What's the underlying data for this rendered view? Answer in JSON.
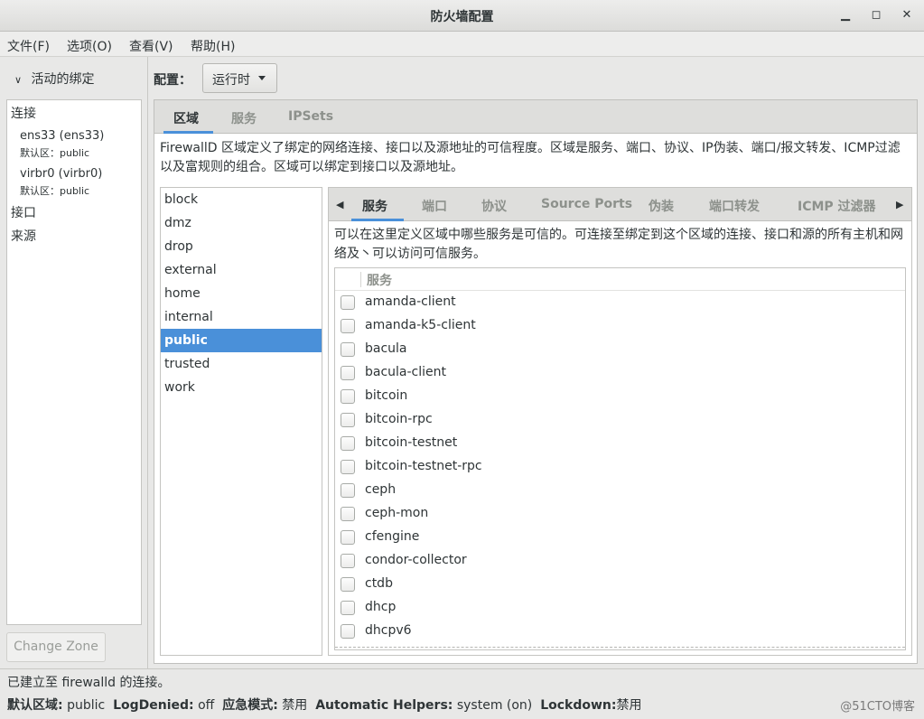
{
  "window": {
    "title": "防火墙配置",
    "minimize": "▁",
    "maximize": "◻",
    "close": "✕"
  },
  "menu": [
    "文件(F)",
    "选项(O)",
    "查看(V)",
    "帮助(H)"
  ],
  "left": {
    "expander_label": "活动的绑定",
    "connections_header": "连接",
    "connections": [
      {
        "name": "ens33 (ens33)",
        "zone": "默认区：public"
      },
      {
        "name": "virbr0 (virbr0)",
        "zone": "默认区：public"
      }
    ],
    "interfaces_header": "接口",
    "sources_header": "来源",
    "change_zone": "Change Zone"
  },
  "config": {
    "label": "配置：",
    "value": "运行时"
  },
  "main_tabs": [
    "区域",
    "服务",
    "IPSets"
  ],
  "zone_description": "FirewallD 区域定义了绑定的网络连接、接口以及源地址的可信程度。区域是服务、端口、协议、IP伪装、端口/报文转发、ICMP过滤以及富规则的组合。区域可以绑定到接口以及源地址。",
  "zones": [
    "block",
    "dmz",
    "drop",
    "external",
    "home",
    "internal",
    "public",
    "trusted",
    "work"
  ],
  "selected_zone": "public",
  "inner_tabs": [
    "服务",
    "端口",
    "协议",
    "Source Ports",
    "伪装",
    "端口转发",
    "ICMP 过滤器"
  ],
  "services_description": "可以在这里定义区域中哪些服务是可信的。可连接至绑定到这个区域的连接、接口和源的所有主机和网络及丶可以访问可信服务。",
  "services_header": "服务",
  "services": [
    "amanda-client",
    "amanda-k5-client",
    "bacula",
    "bacula-client",
    "bitcoin",
    "bitcoin-rpc",
    "bitcoin-testnet",
    "bitcoin-testnet-rpc",
    "ceph",
    "ceph-mon",
    "cfengine",
    "condor-collector",
    "ctdb",
    "dhcp",
    "dhcpv6"
  ],
  "status": {
    "connection": "已建立至  firewalld 的连接。",
    "default_zone_label": "默认区域:",
    "default_zone": "public",
    "logdenied_label": "LogDenied:",
    "logdenied": "off",
    "panic_label": "应急模式:",
    "panic": "禁用",
    "helpers_label": "Automatic Helpers:",
    "helpers": "system (on)",
    "lockdown_label": "Lockdown:",
    "lockdown": "禁用"
  },
  "watermark": "@51CTO博客",
  "colors": {
    "accent": "#4a90d9",
    "selection": "#4a90d9"
  }
}
